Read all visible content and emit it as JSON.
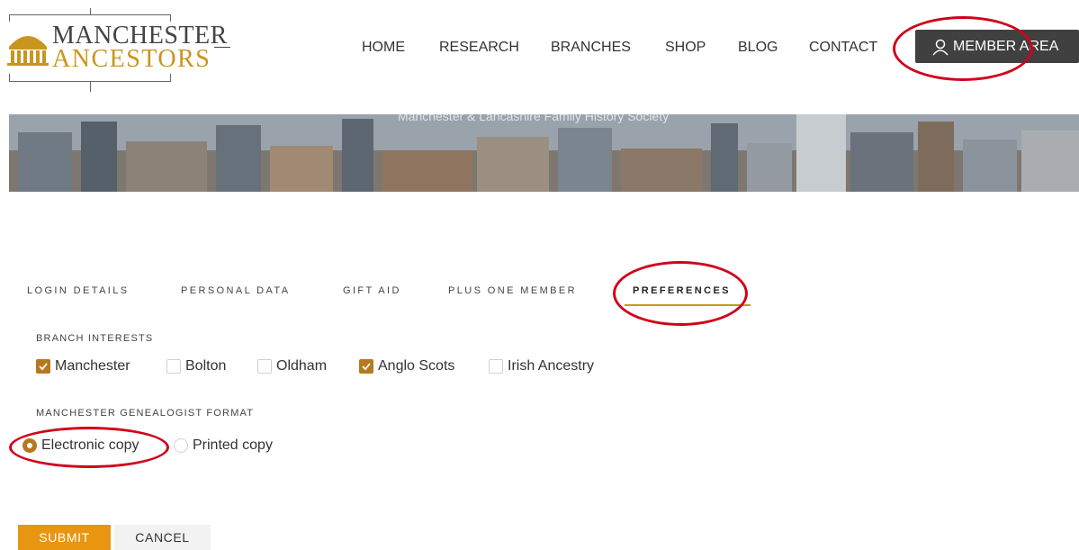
{
  "header": {
    "logo_line1": "MANCHESTER",
    "logo_line2": "ANCESTORS",
    "nav": [
      {
        "label": "HOME"
      },
      {
        "label": "RESEARCH"
      },
      {
        "label": "BRANCHES"
      },
      {
        "label": "SHOP"
      },
      {
        "label": "BLOG"
      },
      {
        "label": "CONTACT"
      }
    ],
    "member_area_label": "MEMBER AREA",
    "member_icon": "user-icon"
  },
  "banner": {
    "subtitle": "Manchester & Lancashire Family History Society"
  },
  "tabs": [
    {
      "label": "LOGIN DETAILS",
      "active": false
    },
    {
      "label": "PERSONAL DATA",
      "active": false
    },
    {
      "label": "GIFT AID",
      "active": false
    },
    {
      "label": "PLUS ONE MEMBER",
      "active": false
    },
    {
      "label": "PREFERENCES",
      "active": true
    }
  ],
  "branch_interests": {
    "label": "BRANCH INTERESTS",
    "options": [
      {
        "label": "Manchester",
        "checked": true
      },
      {
        "label": "Bolton",
        "checked": false
      },
      {
        "label": "Oldham",
        "checked": false
      },
      {
        "label": "Anglo Scots",
        "checked": true
      },
      {
        "label": "Irish Ancestry",
        "checked": false
      }
    ]
  },
  "format": {
    "label": "MANCHESTER GENEALOGIST FORMAT",
    "options": [
      {
        "label": "Electronic copy",
        "selected": true
      },
      {
        "label": "Printed copy",
        "selected": false
      }
    ]
  },
  "actions": {
    "submit_label": "SUBMIT",
    "cancel_label": "CANCEL"
  },
  "colors": {
    "accent": "#c8961e",
    "checkbox_fill": "#b7791f",
    "submit_bg": "#e8960f",
    "member_btn_bg": "#404040",
    "annotation": "#d0021b"
  }
}
